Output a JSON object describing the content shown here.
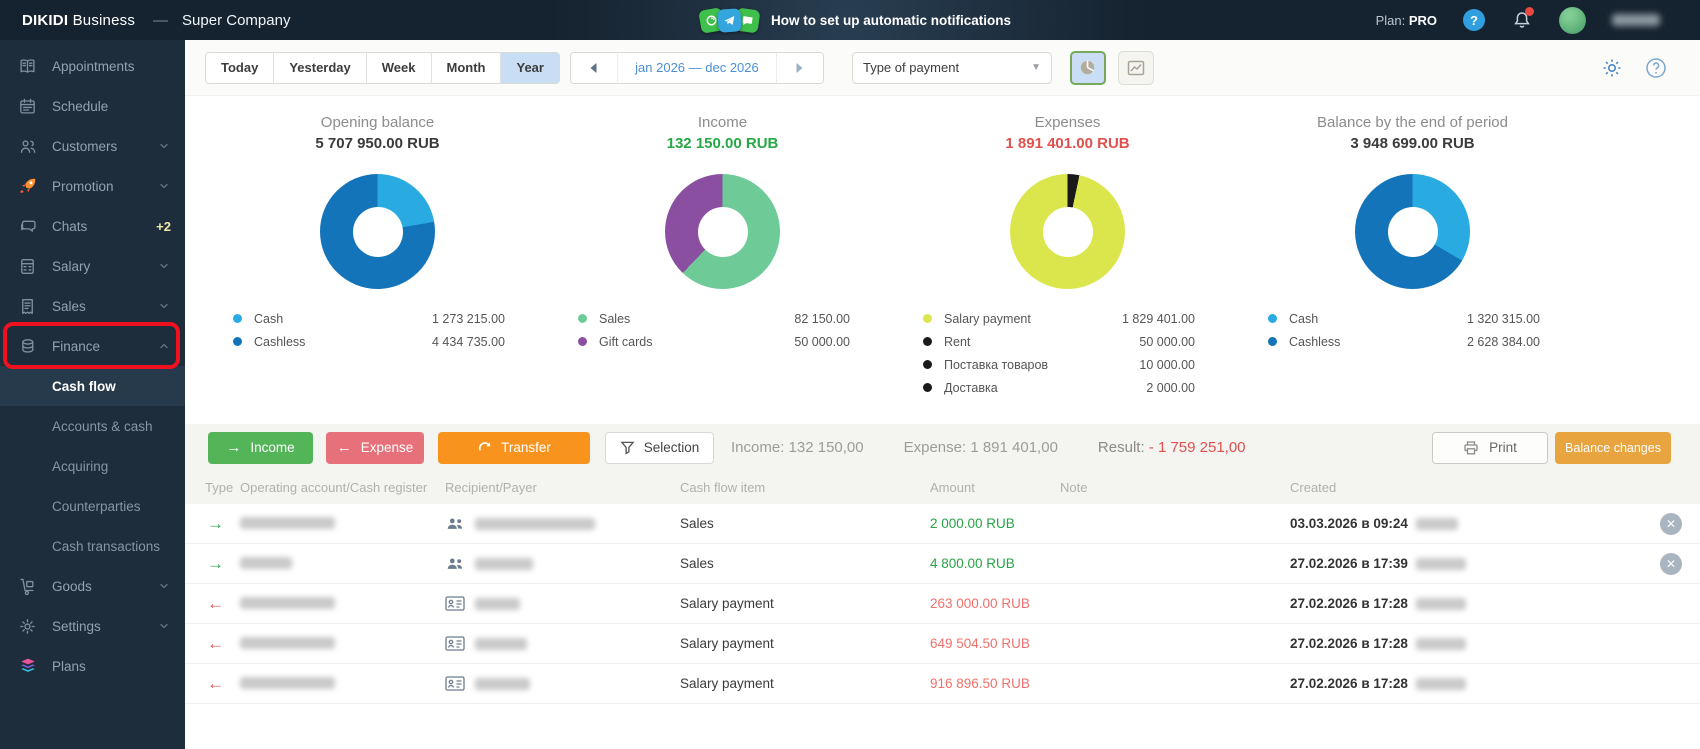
{
  "topbar": {
    "brand": "DIKIDI",
    "brand_suffix": "Business",
    "separator": "—",
    "company": "Super Company",
    "banner_text": "How to set up automatic notifications",
    "plan_label": "Plan:",
    "plan_value": "PRO"
  },
  "sidebar": {
    "items": [
      {
        "label": "Appointments",
        "icon": "appointments-icon"
      },
      {
        "label": "Schedule",
        "icon": "schedule-icon"
      },
      {
        "label": "Customers",
        "icon": "customers-icon",
        "chevron": "down"
      },
      {
        "label": "Promotion",
        "icon": "promotion-icon",
        "chevron": "down"
      },
      {
        "label": "Chats",
        "icon": "chats-icon",
        "badge": "+2"
      },
      {
        "label": "Salary",
        "icon": "salary-icon",
        "chevron": "down"
      },
      {
        "label": "Sales",
        "icon": "sales-icon",
        "chevron": "down"
      },
      {
        "label": "Finance",
        "icon": "finance-icon",
        "chevron": "up",
        "annotated": true
      },
      {
        "label": "Cash flow",
        "sub": true,
        "active": true
      },
      {
        "label": "Accounts & cash",
        "sub": true
      },
      {
        "label": "Acquiring",
        "sub": true
      },
      {
        "label": "Counterparties",
        "sub": true
      },
      {
        "label": "Cash transactions",
        "sub": true
      },
      {
        "label": "Goods",
        "icon": "goods-icon",
        "chevron": "down"
      },
      {
        "label": "Settings",
        "icon": "settings-icon",
        "chevron": "down"
      },
      {
        "label": "Plans",
        "icon": "plans-icon"
      }
    ]
  },
  "toolbar": {
    "presets": [
      "Today",
      "Yesterday",
      "Week",
      "Month",
      "Year"
    ],
    "active_preset": "Year",
    "period": "jan 2026 — dec 2026",
    "payment_type_filter": "Type of payment"
  },
  "chart_data": [
    {
      "type": "pie",
      "title": "Opening balance",
      "total": "5 707 950.00 RUB",
      "total_color": "#3b3b3b",
      "rotate": 0,
      "segments": [
        {
          "label": "Cash",
          "value": 1273215.0,
          "display": "1 273 215.00",
          "color": "#29abe2"
        },
        {
          "label": "Cashless",
          "value": 4434735.0,
          "display": "4 434 735.00",
          "color": "#1374ba"
        }
      ]
    },
    {
      "type": "pie",
      "title": "Income",
      "total": "132 150.00 RUB",
      "total_color": "#27a745",
      "rotate": 0,
      "segments": [
        {
          "label": "Sales",
          "value": 82150.0,
          "display": "82 150.00",
          "color": "#6ecb98"
        },
        {
          "label": "Gift cards",
          "value": 50000.0,
          "display": "50 000.00",
          "color": "#8a4fa0"
        }
      ]
    },
    {
      "type": "pie",
      "title": "Expenses",
      "total": "1 891 401.00 RUB",
      "total_color": "#e0514e",
      "rotate": 12,
      "segments": [
        {
          "label": "Salary payment",
          "value": 1829401.0,
          "display": "1 829 401.00",
          "color": "#dbe64c"
        },
        {
          "label": "Rent",
          "value": 50000.0,
          "display": "50 000.00",
          "color": "#1a1a1a"
        },
        {
          "label": "Поставка товаров",
          "value": 10000.0,
          "display": "10 000.00",
          "color": "#1a1a1a"
        },
        {
          "label": "Доставка",
          "value": 2000.0,
          "display": "2 000.00",
          "color": "#1a1a1a"
        }
      ]
    },
    {
      "type": "pie",
      "title": "Balance by the end of period",
      "total": "3 948 699.00 RUB",
      "total_color": "#3b3b3b",
      "rotate": 0,
      "segments": [
        {
          "label": "Cash",
          "value": 1320315.0,
          "display": "1 320 315.00",
          "color": "#29abe2"
        },
        {
          "label": "Cashless",
          "value": 2628384.0,
          "display": "2 628 384.00",
          "color": "#1374ba"
        }
      ]
    }
  ],
  "action_bar": {
    "income_button": "Income",
    "expense_button": "Expense",
    "transfer_button": "Transfer",
    "selection_button": "Selection",
    "income_total_label": "Income:",
    "income_total": "132 150,00",
    "expense_total_label": "Expense:",
    "expense_total": "1 891 401,00",
    "result_label": "Result:",
    "result_total": "- 1 759 251,00",
    "print_button": "Print",
    "balance_changes_button": "Balance changes"
  },
  "table": {
    "columns": [
      "Type",
      "Operating account/Cash register",
      "Recipient/Payer",
      "Cash flow item",
      "Amount",
      "Note",
      "Created"
    ],
    "rows": [
      {
        "direction": "income",
        "cash_flow_item": "Sales",
        "amount": "2 000.00 RUB",
        "note": "",
        "created": "03.03.2026 в 09:24",
        "recipient_icon": "people-icon",
        "closable": true,
        "redact_widths": [
          95,
          120,
          42
        ]
      },
      {
        "direction": "income",
        "cash_flow_item": "Sales",
        "amount": "4 800.00 RUB",
        "note": "",
        "created": "27.02.2026 в 17:39",
        "recipient_icon": "people-icon",
        "closable": true,
        "redact_widths": [
          52,
          58,
          50
        ]
      },
      {
        "direction": "expense",
        "cash_flow_item": "Salary payment",
        "amount": "263 000.00 RUB",
        "note": "",
        "created": "27.02.2026 в 17:28",
        "recipient_icon": "card-icon",
        "closable": false,
        "redact_widths": [
          95,
          45,
          50
        ]
      },
      {
        "direction": "expense",
        "cash_flow_item": "Salary payment",
        "amount": "649 504.50 RUB",
        "note": "",
        "created": "27.02.2026 в 17:28",
        "recipient_icon": "card-icon",
        "closable": false,
        "redact_widths": [
          95,
          52,
          50
        ]
      },
      {
        "direction": "expense",
        "cash_flow_item": "Salary payment",
        "amount": "916 896.50 RUB",
        "note": "",
        "created": "27.02.2026 в 17:28",
        "recipient_icon": "card-icon",
        "closable": false,
        "redact_widths": [
          95,
          55,
          50
        ]
      }
    ]
  }
}
